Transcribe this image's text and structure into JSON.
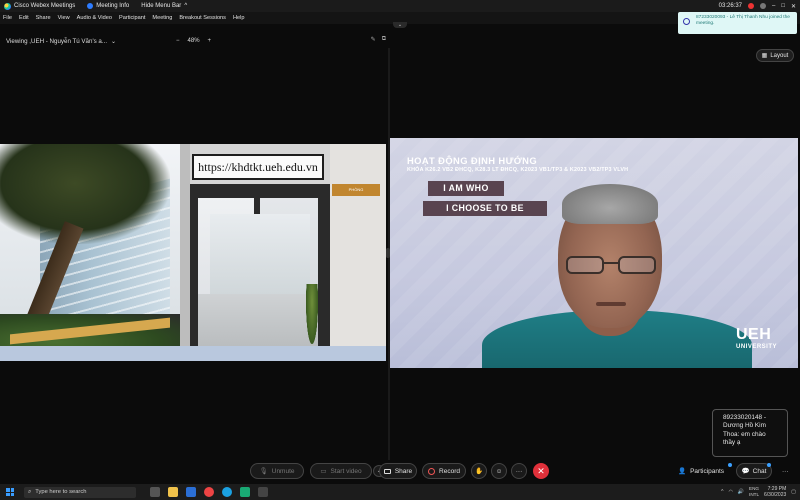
{
  "titlebar": {
    "app_name": "Cisco Webex Meetings",
    "meeting_info": "Meeting Info",
    "hide_menu": "Hide Menu Bar",
    "caret": "^",
    "timer": "03:26:37"
  },
  "menubar": {
    "items": [
      "File",
      "Edit",
      "Share",
      "View",
      "Audio & Video",
      "Participant",
      "Meeting",
      "Breakout Sessions",
      "Help"
    ]
  },
  "viewbar": {
    "viewing": "Viewing ,UEH - Nguyễn Tú Văn's a...",
    "chevron": "⌄",
    "zoom_minus": "−",
    "zoom_value": "48%",
    "zoom_plus": "+"
  },
  "notification": {
    "text": "87233020093 - Lê Thị Thanh Nhu joined the meeting."
  },
  "layout_button": {
    "label": "Layout"
  },
  "shared_content": {
    "url": "https://khdtkt.ueh.edu.vn",
    "phong_label": "PHÒNG"
  },
  "speaker_slide": {
    "title": "HOẠT ĐỘNG ĐỊNH HƯỚNG",
    "subtitle": "KHÓA K26.2 VB2 ĐHCQ, K28.3 LT ĐHCQ, K2023 VB1/TP3 & K2023 VB2/TP3 VLVH",
    "line1": "I AM WHO",
    "line2": "I CHOOSE TO BE",
    "logo": "UEH",
    "logo_sub": "UNIVERSITY"
  },
  "chat_popup": {
    "text": "89233020148 - Dương Hồ Kim Thoa: em chào thầy ạ"
  },
  "controls": {
    "unmute": "Unmute",
    "start_video": "Start video",
    "share": "Share",
    "record": "Record",
    "more": "···",
    "end": "✕",
    "participants": "Participants",
    "chat": "Chat",
    "more_right": "···"
  },
  "taskbar": {
    "search_placeholder": "Type here to search",
    "lang1": "ENG",
    "lang2": "INTL",
    "time": "7:29 PM",
    "date": "6/30/2023"
  },
  "colors": {
    "end_button": "#e0303a",
    "slide_box": "#594450",
    "notification_bg": "#dff7f6"
  }
}
